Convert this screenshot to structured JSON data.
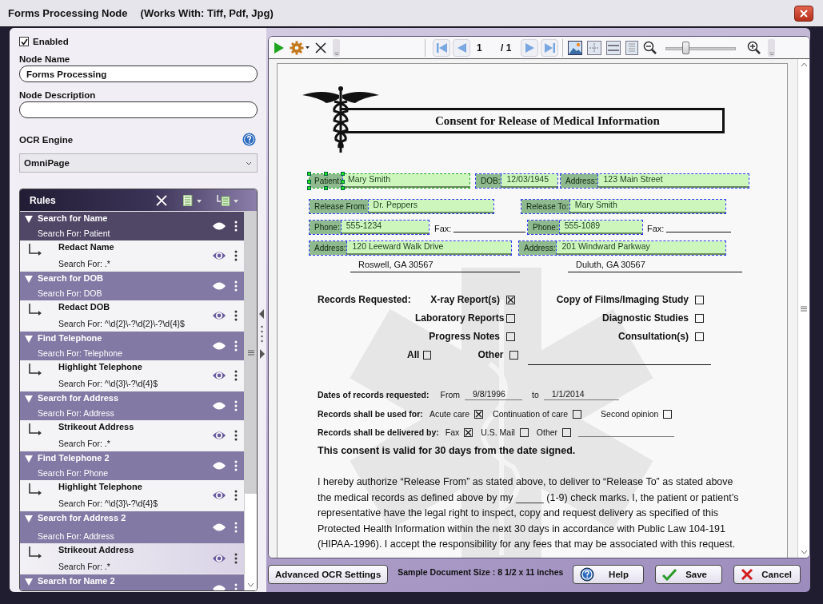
{
  "window": {
    "title": "Forms Processing Node",
    "subtitle": "(Works With: Tiff, Pdf, Jpg)"
  },
  "settings": {
    "enabled": {
      "label": "Enabled",
      "checked": true
    },
    "node_name": {
      "label": "Node Name",
      "value": "Forms Processing"
    },
    "node_description": {
      "label": "Node Description"
    },
    "ocr_engine": {
      "label": "OCR Engine",
      "value": "OmniPage"
    }
  },
  "rules": {
    "title": "Rules",
    "items": [
      {
        "name": "Search for Name",
        "search": "Search For: Patient",
        "selected": true,
        "children": [
          {
            "name": "Redact Name",
            "search": "Search For: .*",
            "hovered": false
          }
        ]
      },
      {
        "name": "Search for DOB",
        "search": "Search For: DOB",
        "selected": false,
        "children": [
          {
            "name": "Redact DOB",
            "search": "Search For: ^\\d{2}\\-?\\d{2}\\-?\\d{4}$",
            "hovered": false
          }
        ]
      },
      {
        "name": "Find Telephone",
        "search": "Search For: Telephone",
        "selected": false,
        "children": [
          {
            "name": "Highlight Telephone",
            "search": "Search For: ^\\d{3}\\-?\\d{4}$",
            "hovered": false
          }
        ]
      },
      {
        "name": "Search for Address",
        "search": "Search For: Address",
        "selected": false,
        "children": [
          {
            "name": "Strikeout Address",
            "search": "Search For: .*",
            "hovered": false
          }
        ]
      },
      {
        "name": "Find Telephone 2",
        "search": "Search For: Phone",
        "selected": false,
        "children": [
          {
            "name": "Highlight Telephone",
            "search": "Search For: ^\\d{3}\\-?\\d{4}$",
            "hovered": false
          }
        ]
      },
      {
        "name": "Search for Address 2",
        "search": "Search For: Address",
        "selected": false,
        "children": [
          {
            "name": "Strikeout Address",
            "search": "Search For: .*",
            "hovered": true
          }
        ]
      },
      {
        "name": "Search for Name 2",
        "selected": false
      }
    ]
  },
  "viewer": {
    "page": "1",
    "page_total": "/ 1",
    "zoom": {
      "level": 0.28
    }
  },
  "document": {
    "title": "Consent for Release of Medical Information",
    "form_rows": [
      [
        {
          "kind": "field",
          "label": "Patient:",
          "value": "Mary Smith",
          "selected": true
        },
        {
          "kind": "field",
          "label": "DOB:",
          "value": "12/03/1945",
          "selected": false
        },
        {
          "kind": "field",
          "label": "Address:",
          "value": "123 Main Street",
          "selected": false
        }
      ],
      [
        {
          "kind": "field",
          "label": "Release From:",
          "value": "Dr. Peppers",
          "selected": false
        },
        {
          "kind": "field",
          "label": "Release To:",
          "value": "Mary Smith",
          "selected": false
        }
      ],
      [
        {
          "kind": "field",
          "label": "Phone:",
          "value": "555-1234",
          "selected": false
        },
        {
          "kind": "blank",
          "label": "Fax:"
        },
        {
          "kind": "field",
          "label": "Phone:",
          "value": "555-1089",
          "selected": false
        },
        {
          "kind": "blank",
          "label": "Fax:"
        }
      ],
      [
        {
          "kind": "field",
          "label": "Address:",
          "value": "120 Leeward Walk Drive",
          "selected": false
        },
        {
          "kind": "field",
          "label": "Address:",
          "value": "201 Windward Parkway",
          "selected": false
        }
      ],
      [
        {
          "kind": "line",
          "value": "Roswell, GA 30567"
        },
        {
          "kind": "line",
          "value": "Duluth, GA 30567"
        }
      ]
    ],
    "records": {
      "label": "Records Requested:",
      "options": [
        {
          "label": "X-ray Report(s)",
          "checked": true
        },
        {
          "label": "Copy of Films/Imaging Study",
          "checked": false
        },
        {
          "label": "Laboratory Reports",
          "checked": false
        },
        {
          "label": "Diagnostic Studies",
          "checked": false
        },
        {
          "label": "Progress Notes",
          "checked": false
        },
        {
          "label": "Consultation(s)",
          "checked": false
        },
        {
          "label": "All",
          "checked": false
        },
        {
          "label": "Other",
          "checked": false
        }
      ]
    },
    "dates": {
      "label": "Dates of records requested:",
      "from_label": "From",
      "from": "9/8/1996",
      "to_label": "to",
      "to": "1/1/2014"
    },
    "used_for": {
      "label": "Records shall be used for:",
      "options": [
        {
          "label": "Acute care",
          "checked": true
        },
        {
          "label": "Continuation of care",
          "checked": false
        },
        {
          "label": "Second opinion",
          "checked": false
        }
      ]
    },
    "delivered_by": {
      "label": "Records shall be delivered by:",
      "options": [
        {
          "label": "Fax",
          "checked": true
        },
        {
          "label": "U.S. Mail",
          "checked": false
        },
        {
          "label": "Other",
          "checked": false
        }
      ]
    },
    "validity": "This consent is valid for 30 days from the date signed.",
    "paragraph_lines": [
      "I hereby authorize  “Release From” as stated above,  to deliver to  “Release To” as stated above",
      "the medical records as defined above by my  _____  (1-9) check marks.  I, the patient or patient’s",
      "representative have the legal right to inspect, copy and request delivery as specified of this",
      "Protected Health Information within the next 30 days in accordance with Public Law 104-191",
      "(HIPAA-1996).  I accept the responsibility for any fees that may be associated with this request."
    ]
  },
  "footer": {
    "advanced_button": "Advanced OCR Settings",
    "document_size": "Sample Document Size : 8 1/2 x 11 inches",
    "buttons": [
      {
        "kind": "help",
        "label": "Help"
      },
      {
        "kind": "save",
        "label": "Save"
      },
      {
        "kind": "cancel",
        "label": "Cancel"
      }
    ]
  }
}
